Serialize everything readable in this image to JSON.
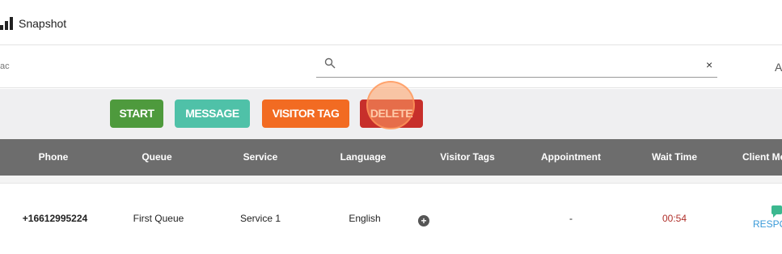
{
  "app": {
    "brand": "Snapshot"
  },
  "search": {
    "left_label": "ac",
    "placeholder": "",
    "value": "",
    "clear_icon": "×",
    "right_label": "A"
  },
  "actions": {
    "start": "START",
    "message": "MESSAGE",
    "visitor_tag": "VISITOR TAG",
    "delete": "DELETE"
  },
  "table": {
    "headers": [
      "Phone",
      "Queue",
      "Service",
      "Language",
      "Visitor Tags",
      "Appointment",
      "Wait Time",
      "Client Me"
    ],
    "rows": [
      {
        "phone": "+16612995224",
        "queue": "First Queue",
        "service": "Service 1",
        "language": "English",
        "visitor_tags_icon": "+",
        "appointment": "-",
        "wait_time": "00:54",
        "client_message": "RESPO"
      }
    ]
  },
  "colors": {
    "start": "#4e9a3d",
    "message": "#4fc1a8",
    "visitor_tag": "#f26b22",
    "delete": "#c72f2b",
    "header_bg": "#6d6d6d",
    "wait_time": "#b0302b",
    "respond": "#3a9ad9"
  },
  "icons": {
    "brand": "signal-bars-icon",
    "search": "search-icon",
    "clear": "close-icon",
    "add_tag": "plus-circle-icon",
    "message": "chat-bubble-icon"
  }
}
